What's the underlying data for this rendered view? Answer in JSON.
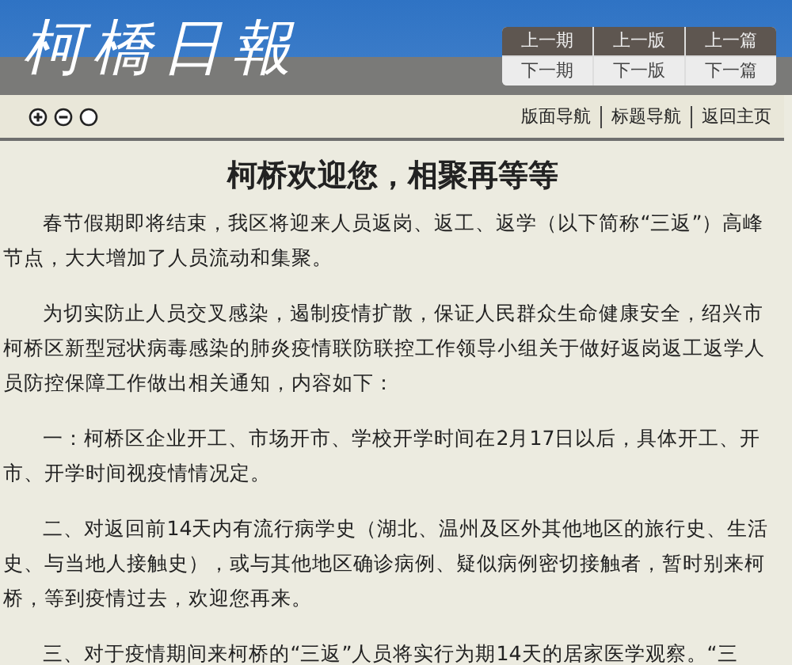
{
  "masthead": {
    "title": "柯橋日報"
  },
  "issue_nav": [
    {
      "label": "上一期",
      "kind": "previous"
    },
    {
      "label": "上一版",
      "kind": "previous"
    },
    {
      "label": "上一篇",
      "kind": "previous"
    },
    {
      "label": "下一期",
      "kind": "next"
    },
    {
      "label": "下一版",
      "kind": "next"
    },
    {
      "label": "下一篇",
      "kind": "next"
    }
  ],
  "font_controls": [
    {
      "kind": "zoom-in"
    },
    {
      "kind": "zoom-out"
    },
    {
      "kind": "reset"
    }
  ],
  "links": [
    "版面导航",
    "标题导航",
    "返回主页"
  ],
  "article": {
    "title": "柯桥欢迎您，相聚再等等",
    "paragraphs": [
      "春节假期即将结束，我区将迎来人员返岗、返工、返学（以下简称“三返”）高峰节点，大大增加了人员流动和集聚。",
      "为切实防止人员交叉感染，遏制疫情扩散，保证人民群众生命健康安全，绍兴市柯桥区新型冠状病毒感染的肺炎疫情联防联控工作领导小组关于做好返岗返工返学人员防控保障工作做出相关通知，内容如下：",
      "一：柯桥区企业开工、市场开市、学校开学时间在2月17日以后，具体开工、开市、开学时间视疫情情况定。",
      "二、对返回前14天内有流行病学史（湖北、温州及区外其他地区的旅行史、生活史、与当地人接触史），或与其他地区确诊病例、疑似病例密切接触者，暂时别来柯桥，等到疫情过去，欢迎您再来。",
      "三、对于疫情期间来柯桥的“三返”人员将实行为期14天的居家医学观察。“三"
    ]
  }
}
